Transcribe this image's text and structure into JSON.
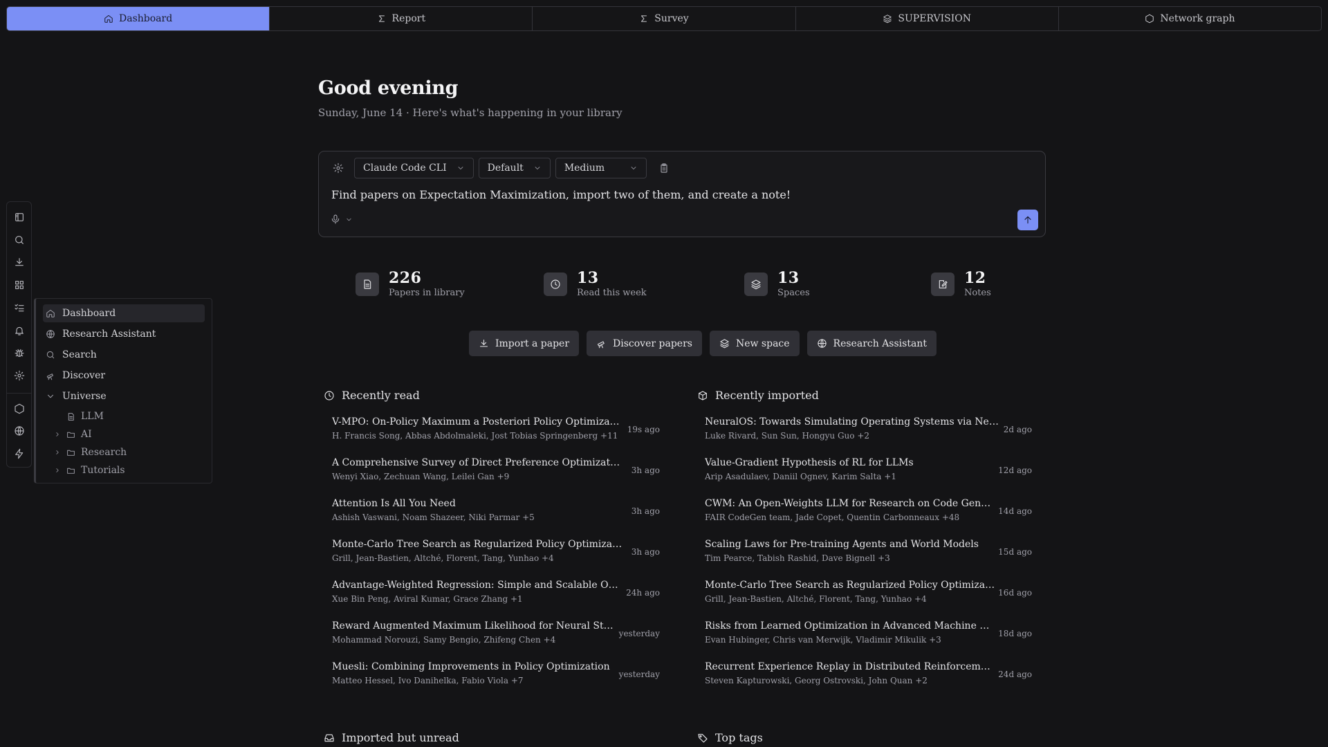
{
  "tabs": [
    {
      "label": "Dashboard",
      "icon": "home-icon",
      "active": true
    },
    {
      "label": "Report",
      "icon": "sigma-icon"
    },
    {
      "label": "Survey",
      "icon": "sigma-icon"
    },
    {
      "label": "SUPERVISION",
      "icon": "layers-icon"
    },
    {
      "label": "Network graph",
      "icon": "hexagon-icon"
    }
  ],
  "rail": [
    "panel-icon",
    "search-icon",
    "download-icon",
    "grid-icon",
    "checklist-icon",
    "bell-icon",
    "bug-icon",
    "gear-icon",
    "hexagon-icon",
    "globe-icon",
    "bolt-icon"
  ],
  "sidebar": {
    "items": [
      {
        "label": "Dashboard",
        "icon": "home-icon"
      },
      {
        "label": "Research Assistant",
        "icon": "globe-icon"
      },
      {
        "label": "Search",
        "icon": "search-icon"
      },
      {
        "label": "Discover",
        "icon": "telescope-icon"
      }
    ],
    "tree": {
      "root": "Universe",
      "children": [
        {
          "label": "LLM",
          "icon": "document-icon"
        },
        {
          "label": "AI",
          "icon": "folder-icon"
        },
        {
          "label": "Research",
          "icon": "folder-icon"
        },
        {
          "label": "Tutorials",
          "icon": "folder-icon"
        }
      ]
    }
  },
  "greeting": "Good evening",
  "subline": "Sunday, June 14 · Here's what's happening in your library",
  "composer": {
    "agent": "Claude Code CLI",
    "mode": "Default",
    "effort": "Medium",
    "prompt": "Find papers on Expectation Maximization, import two of them, and create a note!"
  },
  "stats": [
    {
      "value": "226",
      "label": "Papers in library"
    },
    {
      "value": "13",
      "label": "Read this week"
    },
    {
      "value": "13",
      "label": "Spaces"
    },
    {
      "value": "12",
      "label": "Notes"
    }
  ],
  "actions": [
    {
      "label": "Import a paper"
    },
    {
      "label": "Discover papers"
    },
    {
      "label": "New space"
    },
    {
      "label": "Research Assistant"
    }
  ],
  "recently_read": {
    "title": "Recently read",
    "items": [
      {
        "title": "V-MPO: On-Policy Maximum a Posteriori Policy Optimization for ...",
        "authors": "H. Francis Song, Abbas Abdolmaleki, Jost Tobias Springenberg +11",
        "ago": "19s ago"
      },
      {
        "title": "A Comprehensive Survey of Direct Preference Optimization: Datas...",
        "authors": "Wenyi Xiao, Zechuan Wang, Leilei Gan +9",
        "ago": "3h ago"
      },
      {
        "title": "Attention Is All You Need",
        "authors": "Ashish Vaswani, Noam Shazeer, Niki Parmar +5",
        "ago": "3h ago"
      },
      {
        "title": "Monte-Carlo Tree Search as Regularized Policy Optimization",
        "authors": "Grill, Jean-Bastien, Altché, Florent, Tang, Yunhao +4",
        "ago": "3h ago"
      },
      {
        "title": "Advantage-Weighted Regression: Simple and Scalable Off-Policy R...",
        "authors": "Xue Bin Peng, Aviral Kumar, Grace Zhang +1",
        "ago": "24h ago"
      },
      {
        "title": "Reward Augmented Maximum Likelihood for Neural Structured ...",
        "authors": "Mohammad Norouzi, Samy Bengio, Zhifeng Chen +4",
        "ago": "yesterday"
      },
      {
        "title": "Muesli: Combining Improvements in Policy Optimization",
        "authors": "Matteo Hessel, Ivo Danihelka, Fabio Viola +7",
        "ago": "yesterday"
      }
    ]
  },
  "recently_imported": {
    "title": "Recently imported",
    "items": [
      {
        "title": "NeuralOS: Towards Simulating Operating Systems via Neural Gene...",
        "authors": "Luke Rivard, Sun Sun, Hongyu Guo +2",
        "ago": "2d ago"
      },
      {
        "title": "Value-Gradient Hypothesis of RL for LLMs",
        "authors": "Arip Asadulaev, Daniil Ognev, Karim Salta +1",
        "ago": "12d ago"
      },
      {
        "title": "CWM: An Open-Weights LLM for Research on Code Generation w...",
        "authors": "FAIR CodeGen team, Jade Copet, Quentin Carbonneaux +48",
        "ago": "14d ago"
      },
      {
        "title": "Scaling Laws for Pre-training Agents and World Models",
        "authors": "Tim Pearce, Tabish Rashid, Dave Bignell +3",
        "ago": "15d ago"
      },
      {
        "title": "Monte-Carlo Tree Search as Regularized Policy Optimization",
        "authors": "Grill, Jean-Bastien, Altché, Florent, Tang, Yunhao +4",
        "ago": "16d ago"
      },
      {
        "title": "Risks from Learned Optimization in Advanced Machine Learning ...",
        "authors": "Evan Hubinger, Chris van Merwijk, Vladimir Mikulik +3",
        "ago": "18d ago"
      },
      {
        "title": "Recurrent Experience Replay in Distributed Reinforcement Learni...",
        "authors": "Steven Kapturowski, Georg Ostrovski, John Quan +2",
        "ago": "24d ago"
      }
    ]
  },
  "bottom_sections": [
    "Imported but unread",
    "Top tags"
  ],
  "colors": {
    "accent": "#7b8ff5",
    "background": "#141416",
    "button": "#303036"
  }
}
